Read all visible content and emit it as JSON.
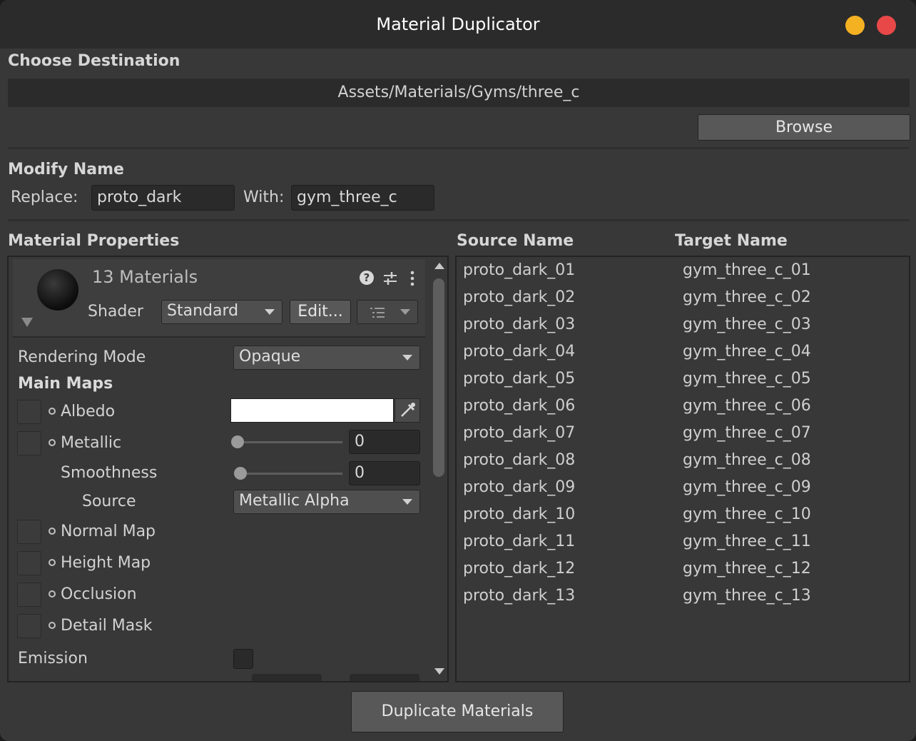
{
  "window": {
    "title": "Material Duplicator"
  },
  "destination": {
    "section_label": "Choose Destination",
    "path": "Assets/Materials/Gyms/three_c",
    "browse_label": "Browse"
  },
  "modify_name": {
    "section_label": "Modify Name",
    "replace_label": "Replace:",
    "replace_value": "proto_dark",
    "with_label": "With:",
    "with_value": "gym_three_c"
  },
  "material_properties": {
    "section_label": "Material Properties",
    "header": {
      "materials_count": "13 Materials",
      "shader_label": "Shader",
      "shader_value": "Standard",
      "edit_label": "Edit..."
    },
    "rendering_mode_label": "Rendering Mode",
    "rendering_mode_value": "Opaque",
    "main_maps_label": "Main Maps",
    "albedo_label": "Albedo",
    "metallic_label": "Metallic",
    "metallic_value": "0",
    "smoothness_label": "Smoothness",
    "smoothness_value": "0",
    "source_label": "Source",
    "source_value": "Metallic Alpha",
    "normal_map_label": "Normal Map",
    "height_map_label": "Height Map",
    "occlusion_label": "Occlusion",
    "detail_mask_label": "Detail Mask",
    "emission_label": "Emission"
  },
  "name_table": {
    "source_header": "Source Name",
    "target_header": "Target Name",
    "rows": [
      {
        "source": "proto_dark_01",
        "target": "gym_three_c_01"
      },
      {
        "source": "proto_dark_02",
        "target": "gym_three_c_02"
      },
      {
        "source": "proto_dark_03",
        "target": "gym_three_c_03"
      },
      {
        "source": "proto_dark_04",
        "target": "gym_three_c_04"
      },
      {
        "source": "proto_dark_05",
        "target": "gym_three_c_05"
      },
      {
        "source": "proto_dark_06",
        "target": "gym_three_c_06"
      },
      {
        "source": "proto_dark_07",
        "target": "gym_three_c_07"
      },
      {
        "source": "proto_dark_08",
        "target": "gym_three_c_08"
      },
      {
        "source": "proto_dark_09",
        "target": "gym_three_c_09"
      },
      {
        "source": "proto_dark_10",
        "target": "gym_three_c_10"
      },
      {
        "source": "proto_dark_11",
        "target": "gym_three_c_11"
      },
      {
        "source": "proto_dark_12",
        "target": "gym_three_c_12"
      },
      {
        "source": "proto_dark_13",
        "target": "gym_three_c_13"
      }
    ]
  },
  "duplicate_label": "Duplicate Materials",
  "colors": {
    "window_bg": "#383838",
    "titlebar_bg": "#2b2b2b",
    "minimize": "#f4b223",
    "close": "#e94848"
  }
}
